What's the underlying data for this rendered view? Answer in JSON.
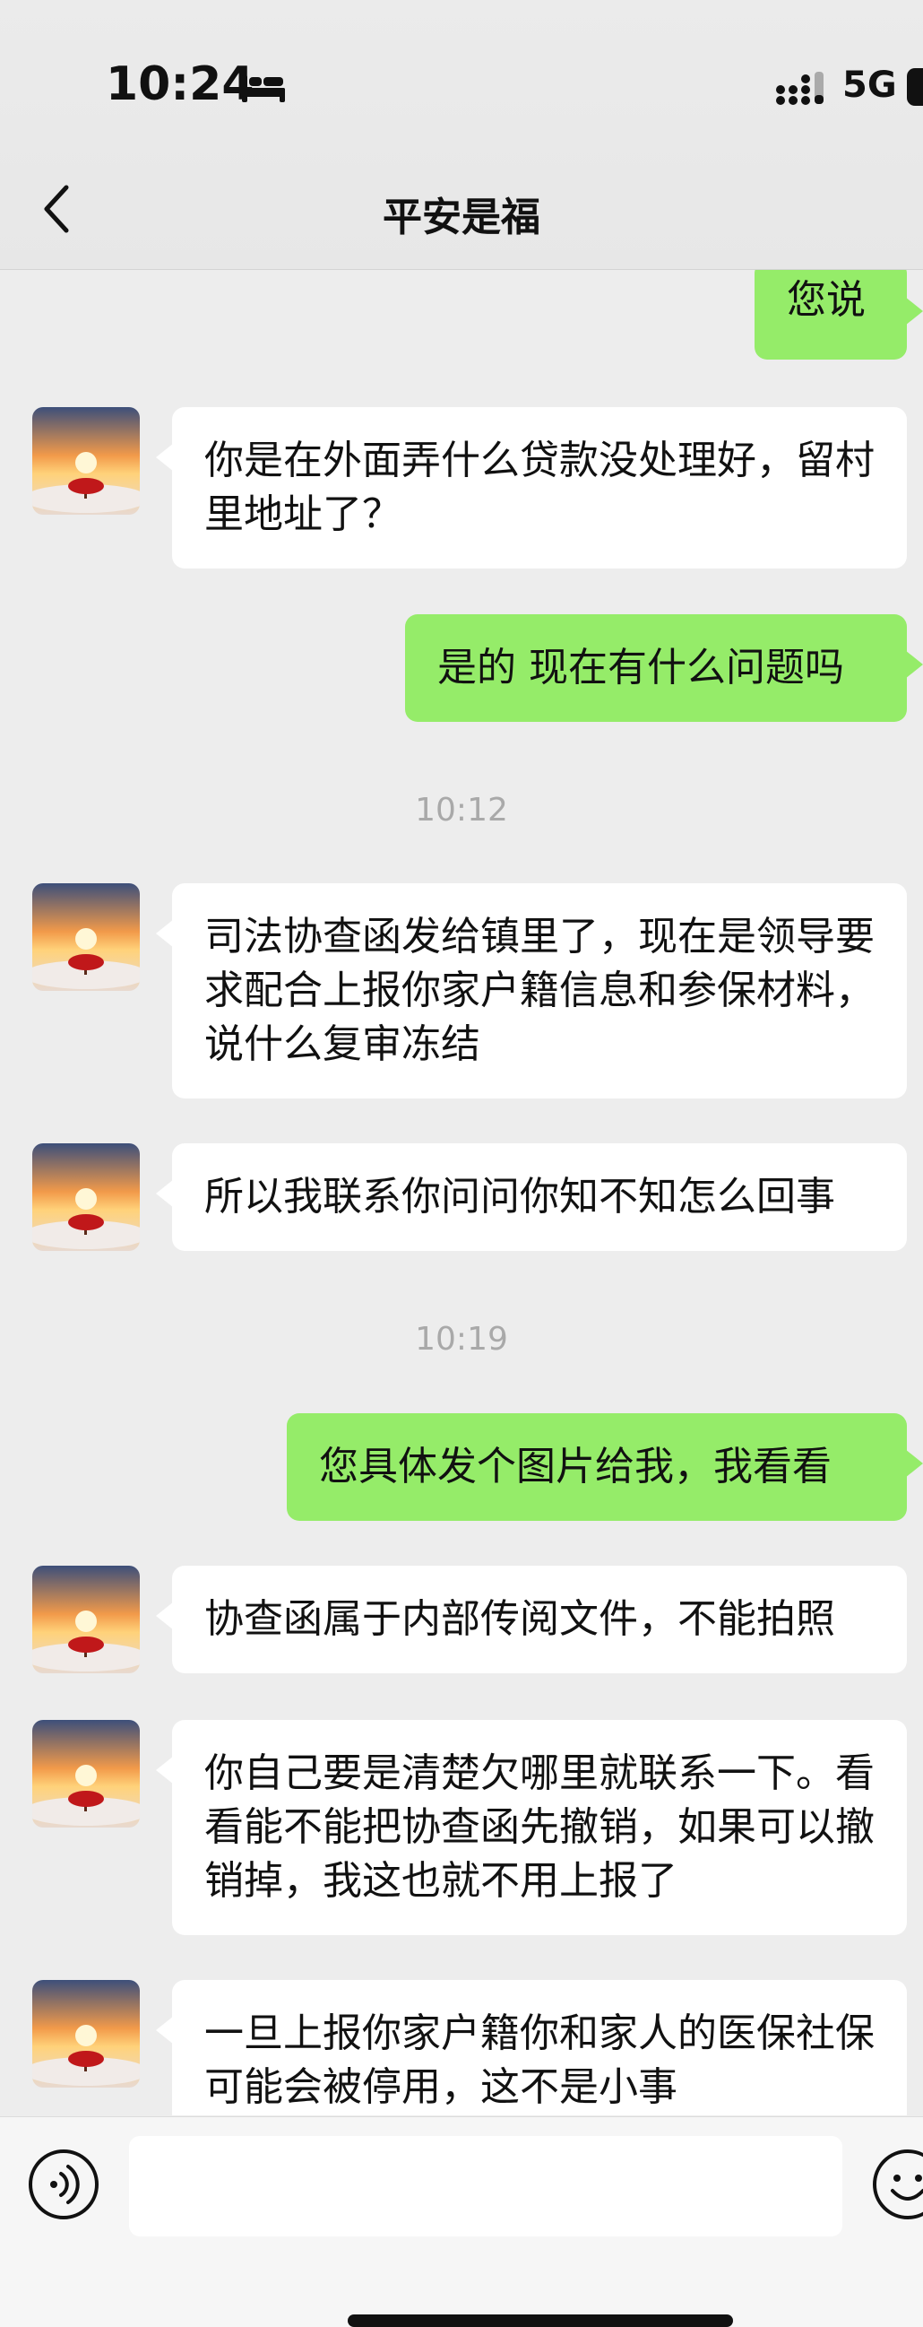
{
  "status_bar": {
    "time": "10:24",
    "network": "5G"
  },
  "header": {
    "title": "平安是福"
  },
  "messages": [
    {
      "side": "out",
      "text": "您说"
    },
    {
      "side": "in",
      "text": "你是在外面弄什么贷款没处理好，留村里地址了？"
    },
    {
      "side": "out",
      "text": "是的 现在有什么问题吗"
    },
    {
      "type": "time",
      "text": "10:12"
    },
    {
      "side": "in",
      "text": "司法协查函发给镇里了，现在是领导要求配合上报你家户籍信息和参保材料，说什么复审冻结"
    },
    {
      "side": "in",
      "text": "所以我联系你问问你知不知怎么回事"
    },
    {
      "type": "time",
      "text": "10:19"
    },
    {
      "side": "out",
      "text": "您具体发个图片给我，我看看"
    },
    {
      "side": "in",
      "text": "协查函属于内部传阅文件，不能拍照"
    },
    {
      "side": "in",
      "text": "你自己要是清楚欠哪里就联系一下。看看能不能把协查函先撤销，如果可以撤销掉，我这也就不用上报了"
    },
    {
      "side": "in",
      "text": "一旦上报你家户籍你和家人的医保社保可能会被停用，这不是小事"
    }
  ],
  "icons": {
    "back": "chevron-left-icon",
    "voice": "voice-icon",
    "emoji": "emoji-icon",
    "bed": "bed-icon",
    "signal": "signal-icon",
    "battery": "battery-icon"
  },
  "colors": {
    "outgoing_bubble": "#95ec69",
    "incoming_bubble": "#ffffff",
    "background": "#ededed"
  }
}
